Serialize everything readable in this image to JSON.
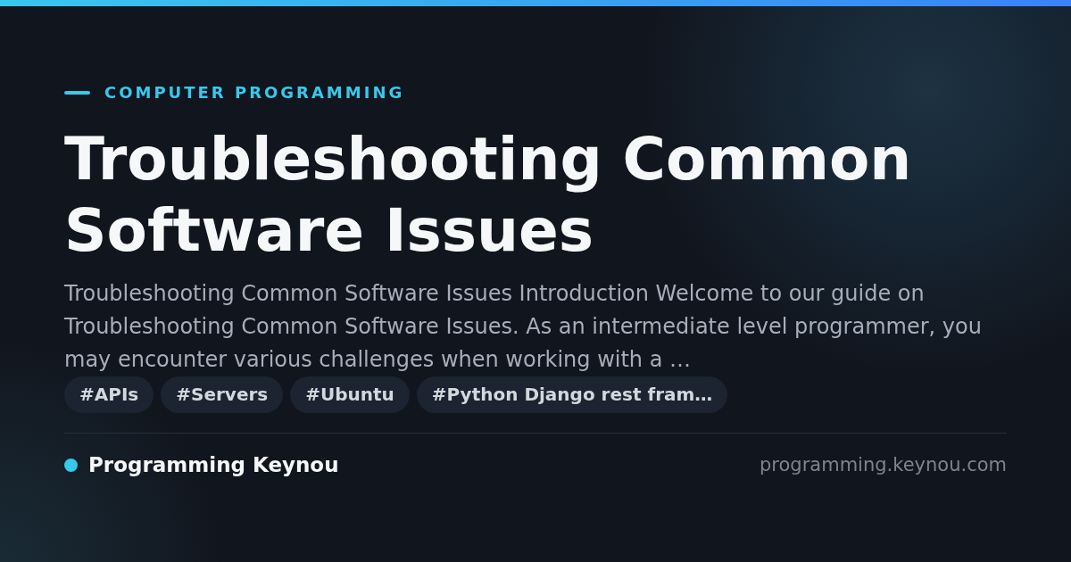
{
  "category": "COMPUTER PROGRAMMING",
  "title": "Troubleshooting Common Software Issues",
  "description": "Troubleshooting Common Software Issues Introduction Welcome to our guide on Troubleshooting Common Software Issues. As an intermediate level programmer, you may encounter various challenges when working with a …",
  "tags": [
    "#APIs",
    "#Servers",
    "#Ubuntu",
    "#Python Django rest fram…"
  ],
  "site_name": "Programming Keynou",
  "domain": "programming.keynou.com"
}
